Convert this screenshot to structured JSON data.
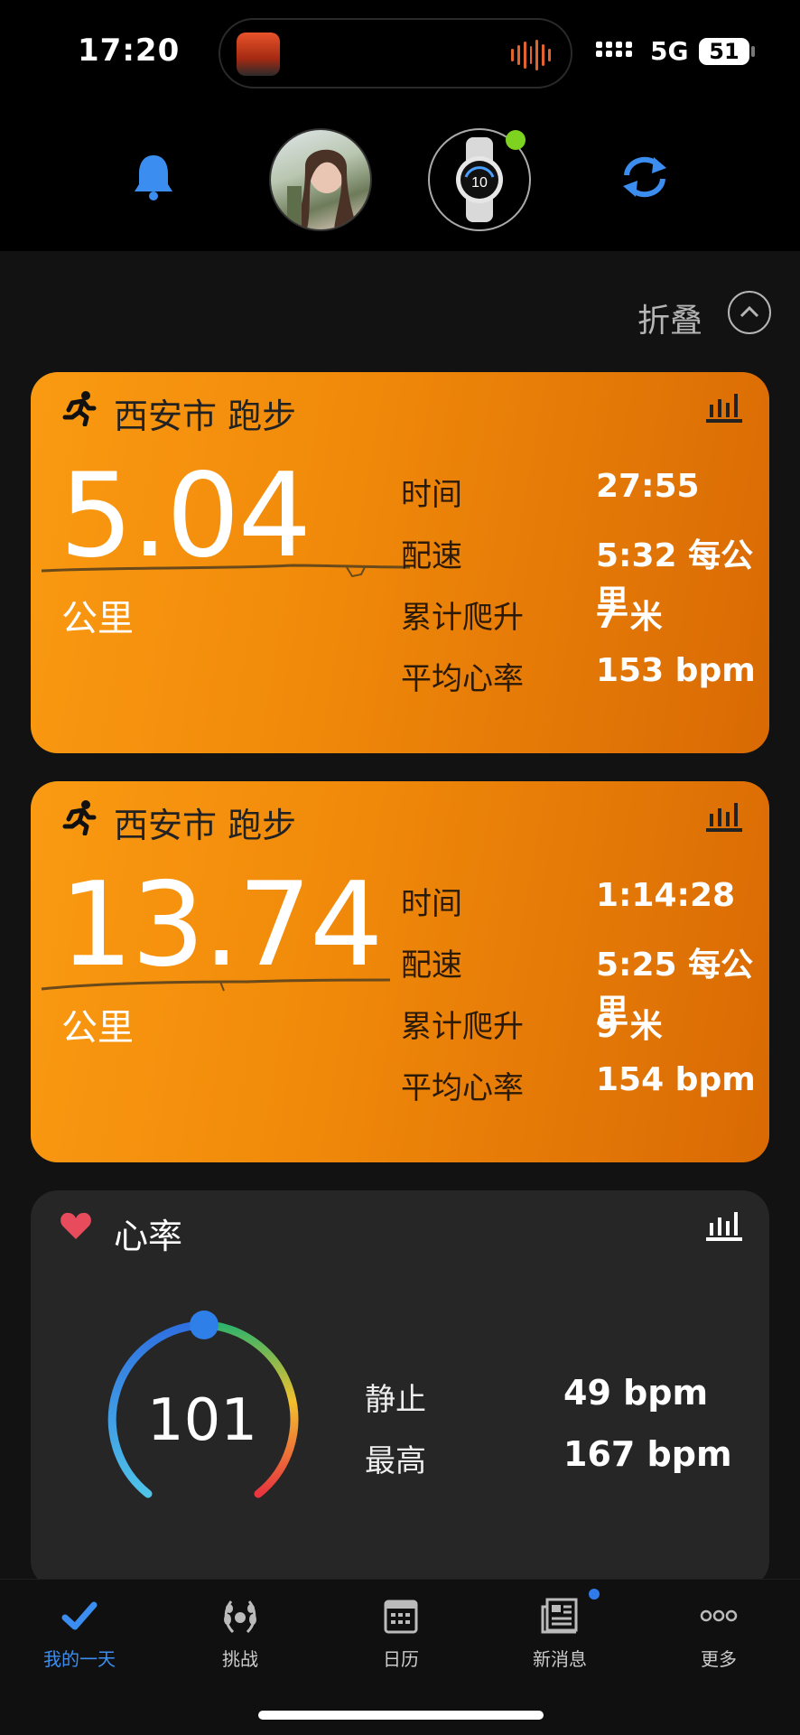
{
  "status_bar": {
    "time": "17:20",
    "network": "5G",
    "battery": "51"
  },
  "colors": {
    "accent": "#3b8ef0",
    "card_orange": "#f18a0a",
    "heart_red": "#e84b5b",
    "sync_badge": "#7ed321"
  },
  "icons": {
    "bell": "bell-icon",
    "avatar": "user-avatar",
    "watch": "watch-icon",
    "sync": "sync-icon"
  },
  "collapse": {
    "label": "折叠"
  },
  "activities": [
    {
      "title": "西安市 跑步",
      "distance": "5.04",
      "unit": "公里",
      "stats": [
        {
          "label": "时间",
          "value": "27:55"
        },
        {
          "label": "配速",
          "value": "5:32 每公里"
        },
        {
          "label": "累计爬升",
          "value": "7 米"
        },
        {
          "label": "平均心率",
          "value": "153 bpm"
        }
      ]
    },
    {
      "title": "西安市 跑步",
      "distance": "13.74",
      "unit": "公里",
      "stats": [
        {
          "label": "时间",
          "value": "1:14:28"
        },
        {
          "label": "配速",
          "value": "5:25 每公里"
        },
        {
          "label": "累计爬升",
          "value": "9 米"
        },
        {
          "label": "平均心率",
          "value": "154 bpm"
        }
      ]
    }
  ],
  "heart_rate": {
    "title": "心率",
    "current": "101",
    "stats": [
      {
        "label": "静止",
        "value": "49 bpm"
      },
      {
        "label": "最高",
        "value": "167 bpm"
      }
    ]
  },
  "tabs": [
    {
      "label": "我的一天",
      "icon": "check-icon",
      "active": true
    },
    {
      "label": "挑战",
      "icon": "laurel-icon",
      "active": false
    },
    {
      "label": "日历",
      "icon": "calendar-icon",
      "active": false
    },
    {
      "label": "新消息",
      "icon": "news-icon",
      "active": false
    },
    {
      "label": "更多",
      "icon": "more-icon",
      "active": false
    }
  ]
}
